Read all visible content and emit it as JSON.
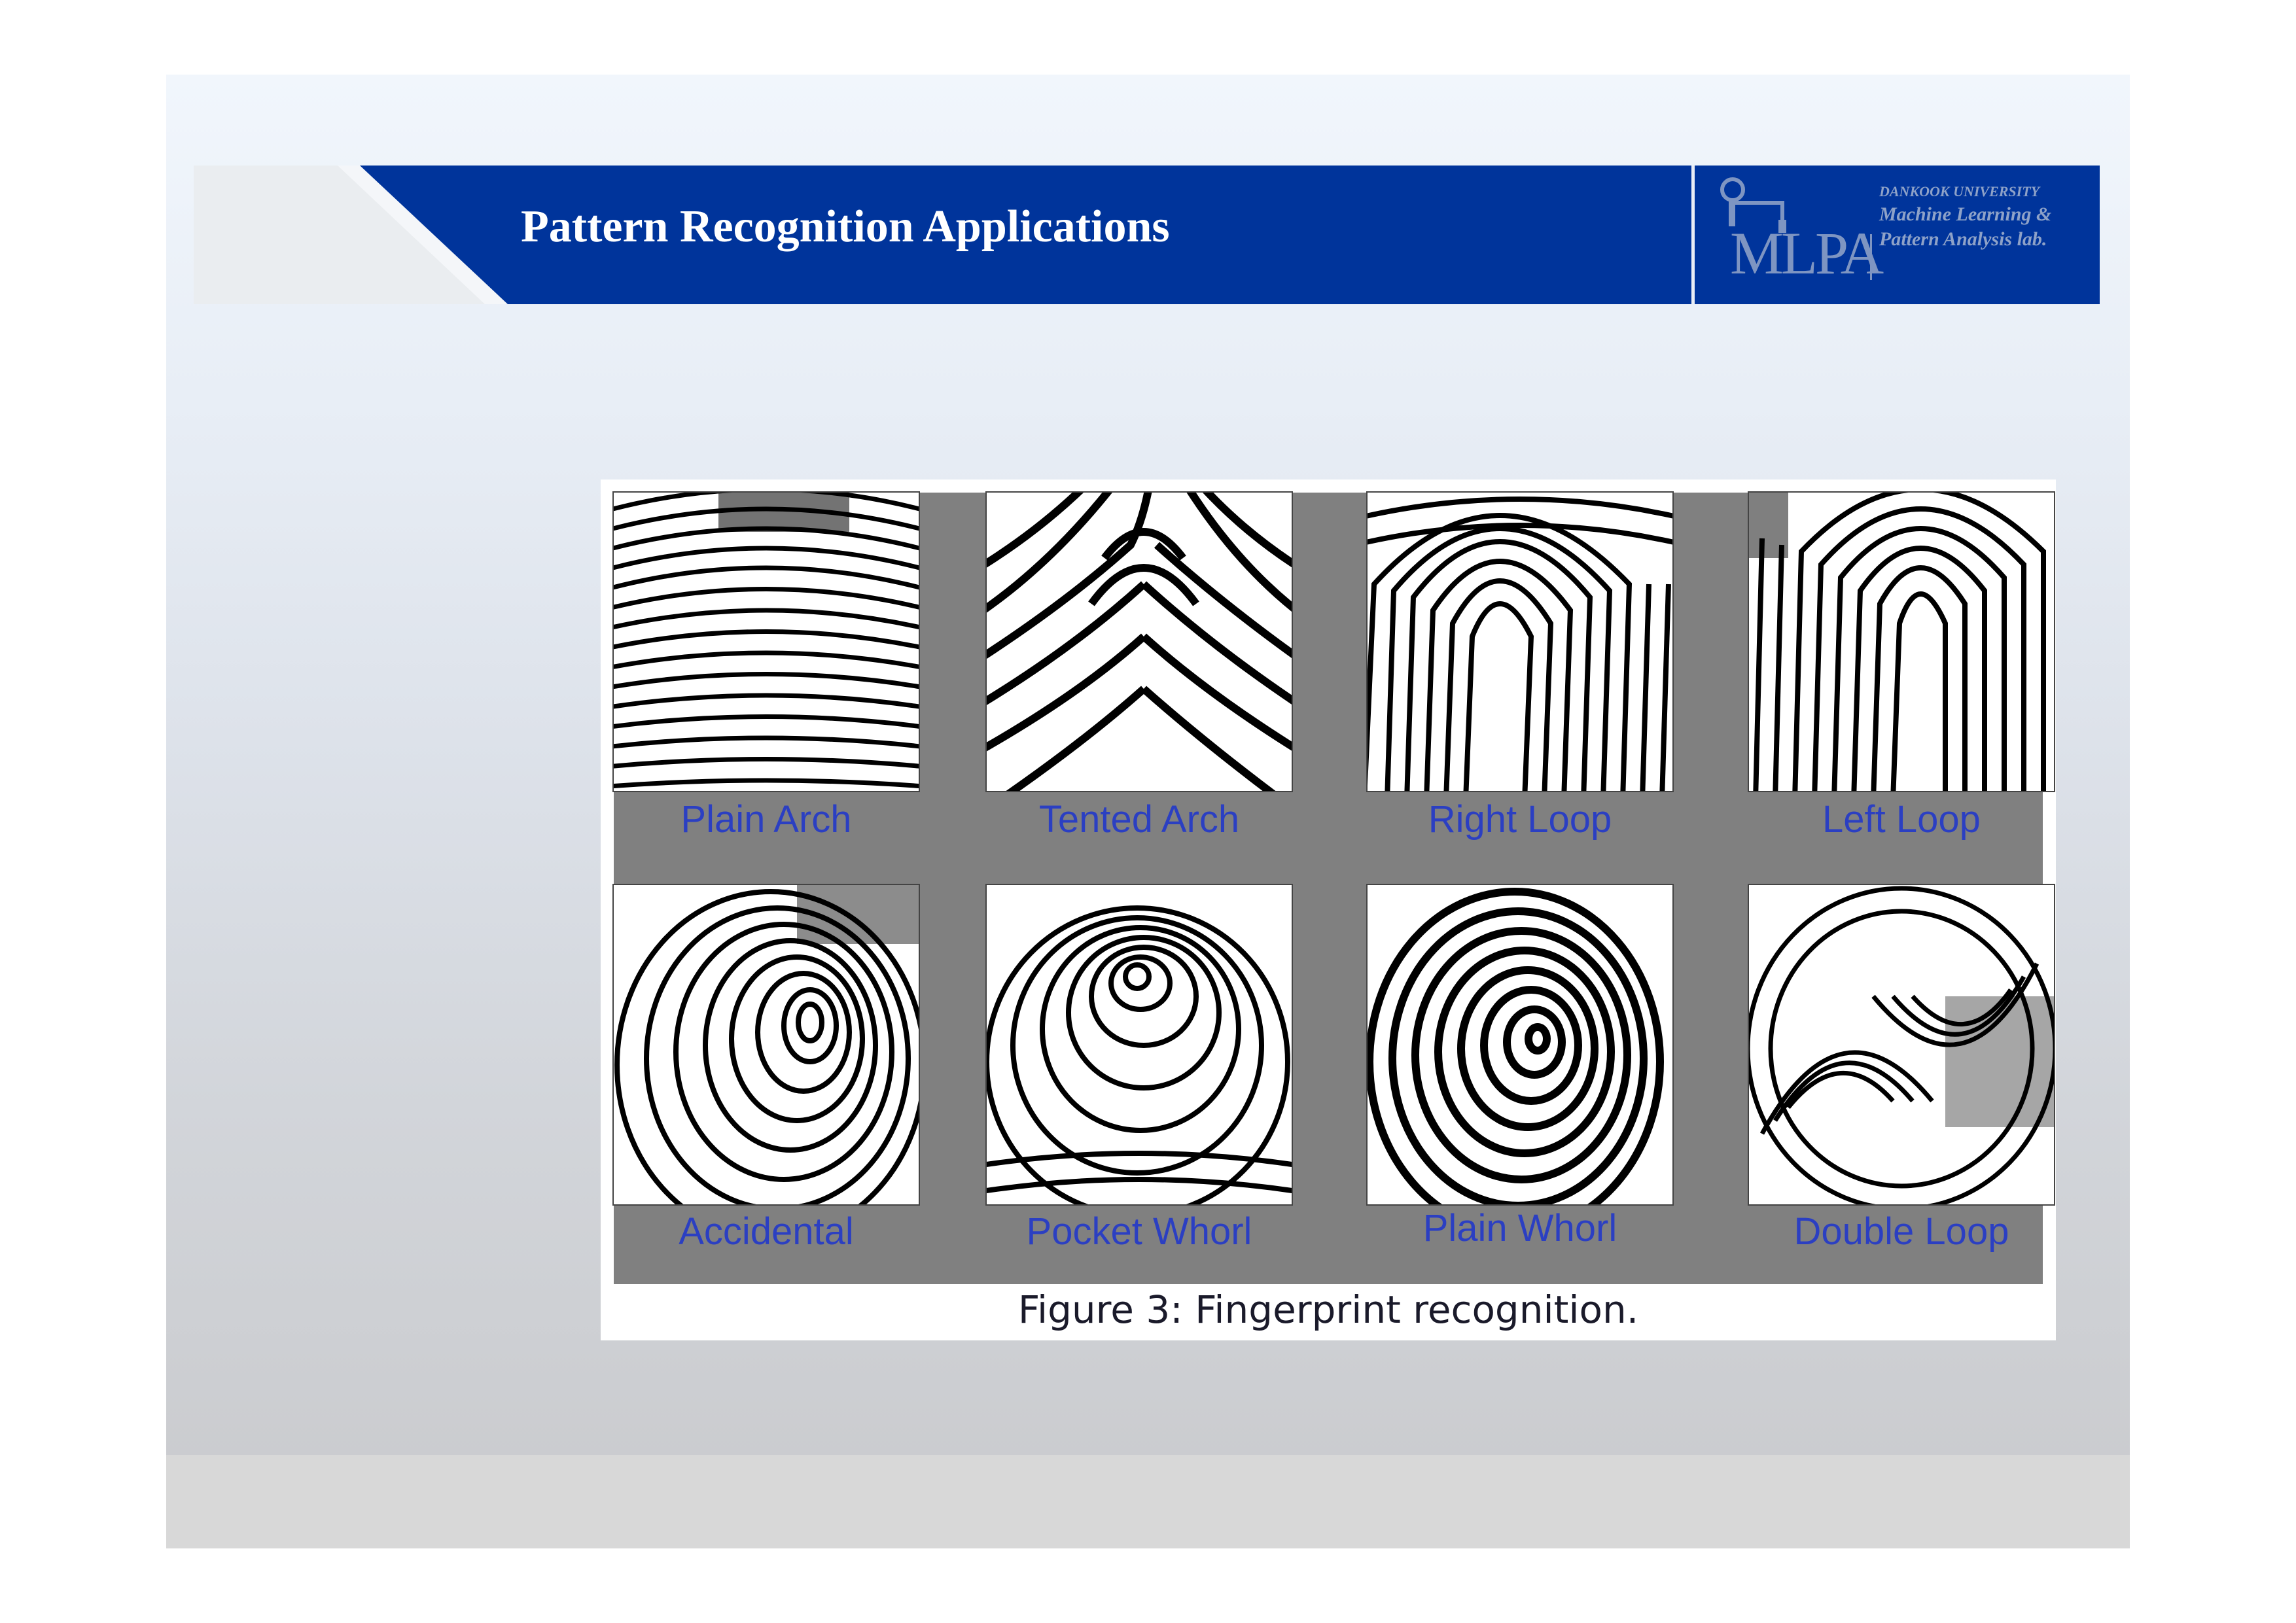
{
  "header": {
    "title": "Pattern Recognition Applications"
  },
  "logo": {
    "mark_text": "MLPA",
    "university": "DANKOOK UNIVERSITY",
    "lab_line1": "Machine Learning &",
    "lab_line2": "Pattern Analysis lab."
  },
  "figure": {
    "caption": "Figure 3: Fingerprint recognition.",
    "fingerprints": [
      {
        "label": "Plain Arch"
      },
      {
        "label": "Tented Arch"
      },
      {
        "label": "Right Loop"
      },
      {
        "label": "Left Loop"
      },
      {
        "label": "Accidental"
      },
      {
        "label": "Pocket Whorl"
      },
      {
        "label": "Plain Whorl"
      },
      {
        "label": "Double Loop"
      }
    ]
  },
  "colors": {
    "header_blue": "#00349b",
    "label_blue": "#2b3fc2",
    "panel_gray": "#808080"
  }
}
